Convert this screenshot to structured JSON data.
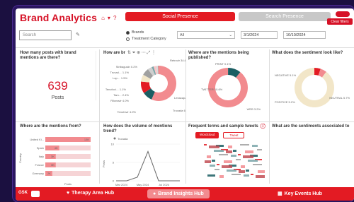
{
  "header": {
    "title": "Brand Analytics",
    "tab_social": "Social Presence",
    "tab_search": "Search Presence",
    "clear_filters": "Clear filters"
  },
  "filters": {
    "search_placeholder": "Search",
    "radio_brands": "Brands",
    "radio_treatment": "Treatment Category",
    "dropdown_value": "All",
    "date_start": "3/1/2024",
    "date_end": "10/10/2024"
  },
  "panels": {
    "posts": {
      "title": "How many posts with brand mentions are there?",
      "value": "639",
      "unit": "Posts"
    },
    "brands": {
      "title": "How are br"
    },
    "published": {
      "title": "Where are the mentions being published?"
    },
    "sentiment": {
      "title": "What does the sentiment look like?"
    },
    "from": {
      "title": "Where are the mentions from?"
    },
    "volume": {
      "title": "How does the volume of mentions trend?"
    },
    "terms": {
      "title": "Frequent terms and sample tweets",
      "btn_wordcloud": "Wordcloud",
      "btn_tweet": "Tweet"
    },
    "sentiment_assoc": {
      "title": "What are the sentiments associated to"
    }
  },
  "chart_data": [
    {
      "type": "pie",
      "labels": [
        "Retrovir",
        "Lenacapa",
        "Truvada",
        "Tenofovir",
        "Rilonavir",
        "Tam",
        "Tenofovi",
        "Lop",
        "Truvad",
        "Stribagusin"
      ],
      "values": [
        34.6,
        5.6,
        6.7,
        4.0,
        4.0,
        2.4,
        1.1,
        1.5,
        1.1,
        0.2
      ],
      "value_labels": [
        "Retrovir 34.6%",
        "Lenacapa 5.6%",
        "Truvada 6.7%",
        "Tenofovir 4.0%",
        "Rilonavir 4.0%",
        "Tam… 2.4%",
        "Tenofovi… 1.1%",
        "Lop… 1.5%",
        "Truvad… 1.1%",
        "Stribagusin 0.2%"
      ]
    },
    {
      "type": "pie",
      "labels": [
        "PRINT",
        "TWITTER",
        "WEB"
      ],
      "values": [
        0.1,
        10.6,
        89.3
      ],
      "value_labels": [
        "PRINT 0.1%",
        "TWITTER 10.6%",
        "WEB 3.2%"
      ]
    },
    {
      "type": "pie",
      "labels": [
        "NEGATIVE",
        "POSITIVE",
        "NEUTRAL"
      ],
      "values": [
        5.1,
        5.2,
        89.7
      ],
      "value_labels": [
        "NEGATIVE 5.1%",
        "POSITIVE 5.2%",
        "NEUTRAL 5.7%"
      ]
    },
    {
      "type": "bar",
      "categories": [
        "United Ki...",
        "Spain",
        "Italy",
        "France",
        "Germany"
      ],
      "values": [
        13,
        4,
        3,
        3,
        2
      ],
      "value_labels": [
        "13K",
        "4K",
        "3K",
        "3K",
        "2K"
      ],
      "ylabel": "Country",
      "xlabel": "Posts"
    },
    {
      "type": "line",
      "legend": "Truvada",
      "x": [
        "Mar 2024",
        "May 2024",
        "Jul 2024"
      ],
      "series": [
        {
          "name": "Truvada",
          "values": [
            0,
            0,
            1,
            8,
            0,
            0,
            0
          ]
        }
      ],
      "ylabel": "Posts",
      "ylim": [
        0,
        10
      ],
      "yticks": [
        "0",
        "5",
        "10"
      ]
    }
  ],
  "footer": {
    "logo": "GSK",
    "tab1": "Therapy Area Hub",
    "tab2": "Brand Insights Hub",
    "tab3": "Key Events Hub"
  },
  "colors": {
    "brand_red": "#e31b23",
    "pink": "#f28b8f",
    "teal": "#1b5e63",
    "cream": "#f2e6c8"
  }
}
